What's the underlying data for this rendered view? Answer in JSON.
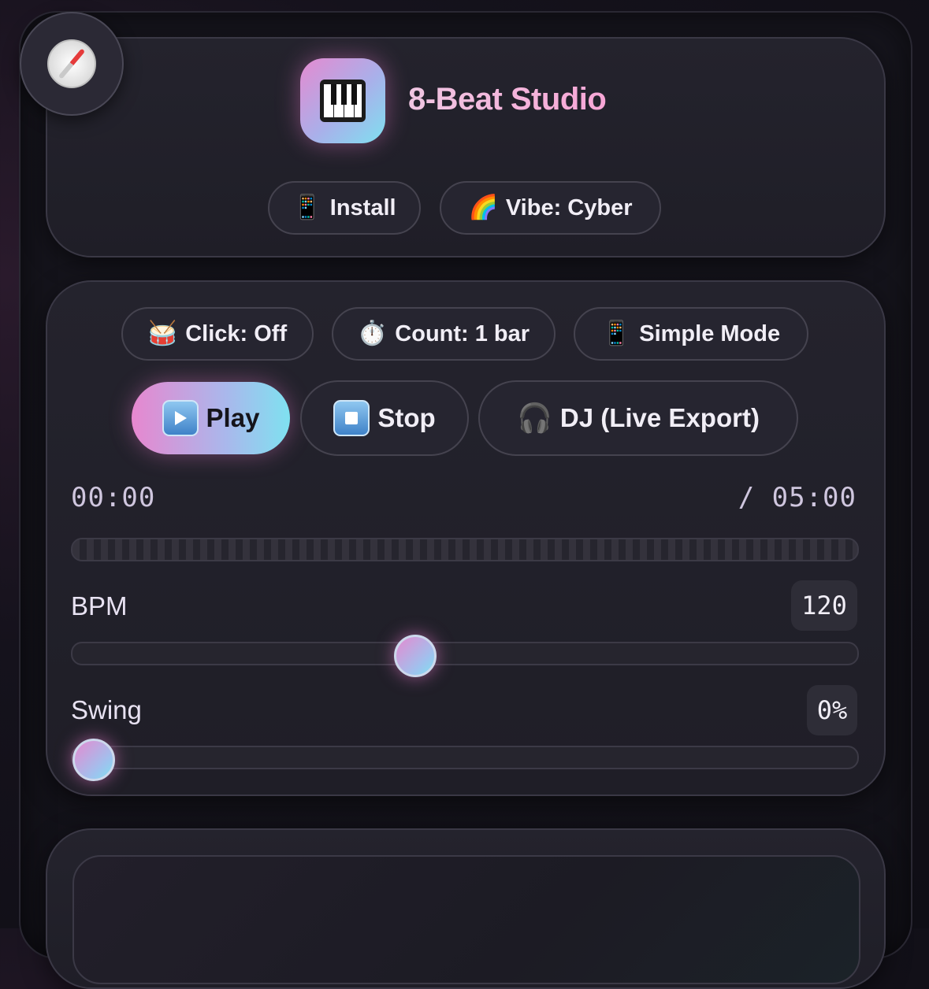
{
  "app": {
    "title": "8-Beat Studio",
    "logo_icon": "piano-keys-icon",
    "nav_icon": "compass-icon"
  },
  "header": {
    "install_label": "Install",
    "install_icon": "mobile-phone-icon",
    "vibe_label": "Vibe: Cyber",
    "vibe_icon": "rainbow-icon"
  },
  "toggles": {
    "click_label": "Click: Off",
    "click_icon": "drum-icon",
    "count_label": "Count: 1 bar",
    "count_icon": "stopwatch-icon",
    "mode_label": "Simple Mode",
    "mode_icon": "mobile-phone-icon"
  },
  "transport": {
    "play_label": "Play",
    "stop_label": "Stop",
    "dj_label": "DJ (Live Export)",
    "dj_icon": "headphones-icon"
  },
  "time": {
    "current": "00:00",
    "total": "/ 05:00",
    "progress_fraction": 0.0
  },
  "bpm": {
    "label": "BPM",
    "value": "120",
    "slider_fraction": 0.43
  },
  "swing": {
    "label": "Swing",
    "value": "0%",
    "slider_fraction": 0.0
  },
  "colors": {
    "accent_pink": "#e58ad0",
    "accent_cyan": "#7fe0f0",
    "background": "#15121c"
  }
}
